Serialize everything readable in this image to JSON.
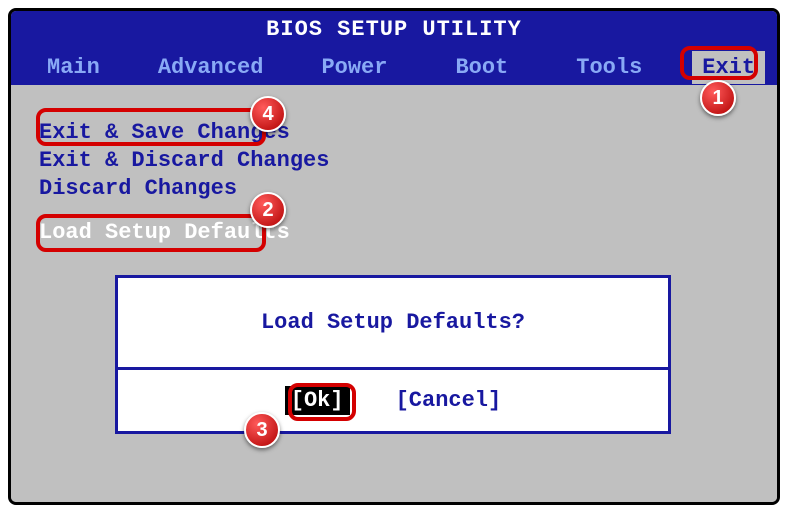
{
  "header": {
    "title": "BIOS SETUP UTILITY",
    "tabs": [
      {
        "label": "Main"
      },
      {
        "label": "Advanced"
      },
      {
        "label": "Power"
      },
      {
        "label": "Boot"
      },
      {
        "label": "Tools"
      },
      {
        "label": "Exit",
        "active": true
      }
    ]
  },
  "menu": {
    "items": [
      {
        "label": "Exit & Save Changes"
      },
      {
        "label": "Exit & Discard Changes"
      },
      {
        "label": "Discard Changes"
      },
      {
        "label": "Load Setup Defaults",
        "highlight": true
      }
    ]
  },
  "dialog": {
    "title": "Load Setup Defaults?",
    "ok": "[Ok]",
    "cancel": "[Cancel]"
  },
  "annotations": {
    "n1": "1",
    "n2": "2",
    "n3": "3",
    "n4": "4"
  }
}
